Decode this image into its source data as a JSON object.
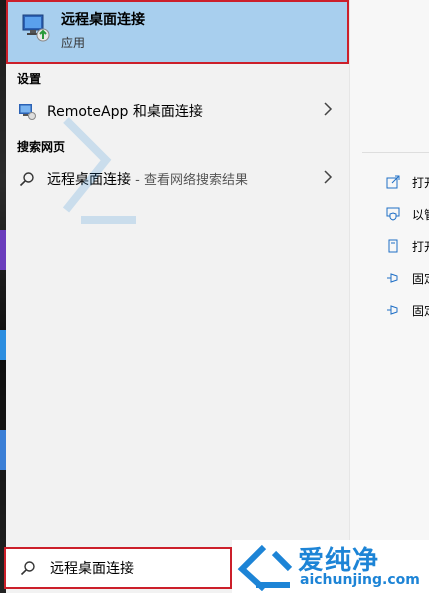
{
  "best_match": {
    "title": "远程桌面连接",
    "subtitle": "应用"
  },
  "settings": {
    "heading": "设置",
    "items": [
      {
        "label": "RemoteApp 和桌面连接"
      }
    ]
  },
  "web": {
    "heading": "搜索网页",
    "items": [
      {
        "label": "远程桌面连接",
        "suffix": " - 查看网络搜索结果"
      }
    ]
  },
  "details": {
    "actions": [
      {
        "label": "打开",
        "icon": "open-icon"
      },
      {
        "label": "以管理员身份运行",
        "icon": "shield-icon"
      },
      {
        "label": "打开文件位置",
        "icon": "file-location-icon"
      },
      {
        "label": "固定到开始屏幕",
        "icon": "pin-icon"
      },
      {
        "label": "固定到任务栏",
        "icon": "pin-icon"
      }
    ]
  },
  "search": {
    "value": "远程桌面连接"
  },
  "watermark": {
    "brand": "爱纯净",
    "url": "aichunjing.com"
  },
  "colors": {
    "highlight": "#a8cfee",
    "annotation_red": "#cc1f2a",
    "accent": "#1d84d6"
  }
}
